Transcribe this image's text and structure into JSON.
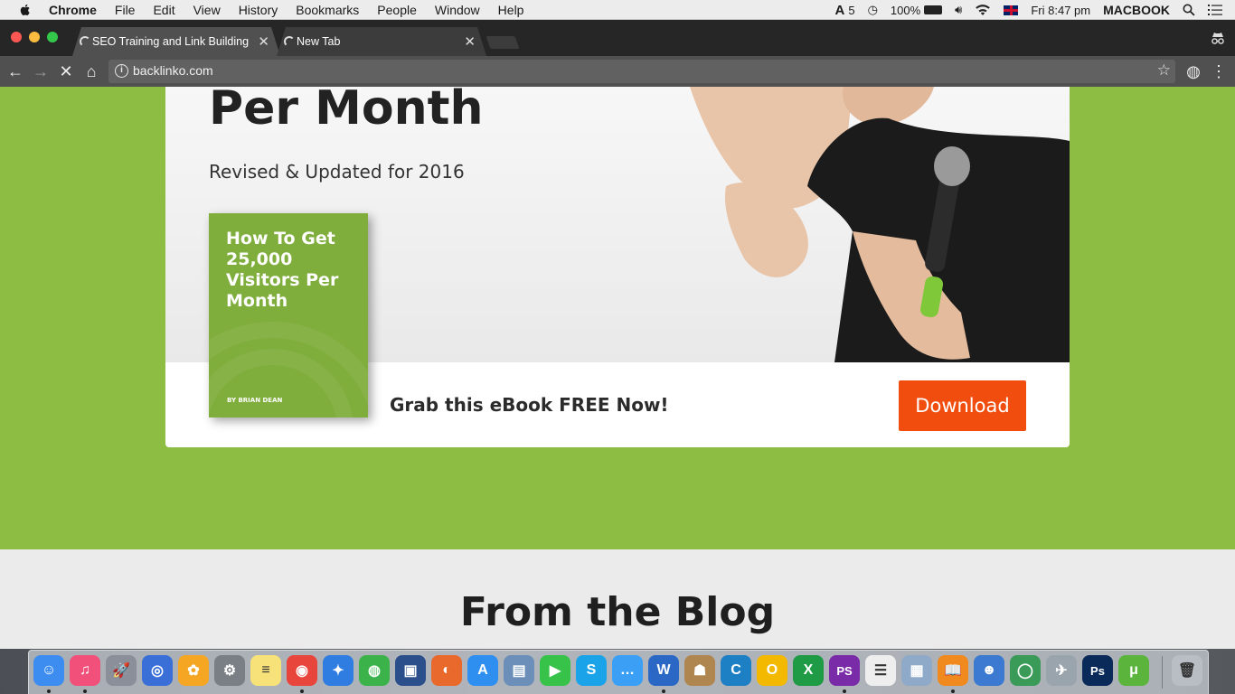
{
  "menubar": {
    "app_name": "Chrome",
    "items": [
      "File",
      "Edit",
      "View",
      "History",
      "Bookmarks",
      "People",
      "Window",
      "Help"
    ],
    "adobe_count": "5",
    "battery": "100%",
    "clock": "Fri 8:47 pm",
    "user": "MACBOOK"
  },
  "tabs": [
    {
      "label": "SEO Training and Link Building",
      "close": "✕"
    },
    {
      "label": "New Tab",
      "close": "✕"
    }
  ],
  "toolbar": {
    "url": "backlinko.com"
  },
  "hero": {
    "title": "Per Month",
    "subtitle": "Revised & Updated for 2016"
  },
  "ebook": {
    "title": "How To Get 25,000 Visitors Per Month",
    "author": "BY BRIAN DEAN"
  },
  "cta": {
    "text": "Grab this eBook FREE Now!",
    "button": "Download"
  },
  "blog": {
    "title": "From the Blog"
  },
  "colors": {
    "page_green": "#8dbd42",
    "download_orange": "#f04d0f",
    "ebook_green": "#7fae3c"
  },
  "dock": [
    {
      "name": "finder",
      "color": "#3d8cf0",
      "glyph": "☺"
    },
    {
      "name": "itunes",
      "color": "#f0507a",
      "glyph": "♫"
    },
    {
      "name": "launchpad",
      "color": "#8a8f99",
      "glyph": "🚀"
    },
    {
      "name": "ios-app",
      "color": "#3a6fd8",
      "glyph": "◎"
    },
    {
      "name": "photos",
      "color": "#f5a623",
      "glyph": "✿"
    },
    {
      "name": "system-preferences",
      "color": "#7a7e85",
      "glyph": "⚙"
    },
    {
      "name": "notes",
      "color": "#f7e27a",
      "glyph": "≡"
    },
    {
      "name": "chrome",
      "color": "#e8453c",
      "glyph": "◉"
    },
    {
      "name": "safari",
      "color": "#2f7de1",
      "glyph": "✦"
    },
    {
      "name": "network-app",
      "color": "#3bb34a",
      "glyph": "◍"
    },
    {
      "name": "remote-app",
      "color": "#2a4f8a",
      "glyph": "▣"
    },
    {
      "name": "firefox",
      "color": "#e8692b",
      "glyph": "◐"
    },
    {
      "name": "app-store",
      "color": "#2e8ff0",
      "glyph": "A"
    },
    {
      "name": "preview",
      "color": "#6b8fb8",
      "glyph": "▤"
    },
    {
      "name": "facetime",
      "color": "#37c24a",
      "glyph": "▶"
    },
    {
      "name": "skype",
      "color": "#1aa3e8",
      "glyph": "S"
    },
    {
      "name": "messages",
      "color": "#3ba0f5",
      "glyph": "…"
    },
    {
      "name": "word",
      "color": "#2b68c5",
      "glyph": "W"
    },
    {
      "name": "contacts",
      "color": "#b08650",
      "glyph": "☗"
    },
    {
      "name": "c-app",
      "color": "#1d7fc4",
      "glyph": "C"
    },
    {
      "name": "outlook",
      "color": "#f2b900",
      "glyph": "O"
    },
    {
      "name": "excel",
      "color": "#1f9a45",
      "glyph": "X"
    },
    {
      "name": "phpstorm",
      "color": "#7a2ba8",
      "glyph": "PS"
    },
    {
      "name": "reminders",
      "color": "#eeeeee",
      "glyph": "☰"
    },
    {
      "name": "image-capture",
      "color": "#8fa9c9",
      "glyph": "▦"
    },
    {
      "name": "ibooks",
      "color": "#f08a1e",
      "glyph": "📖"
    },
    {
      "name": "people-app",
      "color": "#3b7ad0",
      "glyph": "☻"
    },
    {
      "name": "globe-app",
      "color": "#3a9b58",
      "glyph": "◯"
    },
    {
      "name": "network-radar",
      "color": "#9aa4ad",
      "glyph": "✈"
    },
    {
      "name": "photoshop",
      "color": "#0a2a5a",
      "glyph": "Ps"
    },
    {
      "name": "utorrent",
      "color": "#5bb53c",
      "glyph": "μ"
    },
    {
      "name": "trash",
      "color": "#b9bec4",
      "glyph": "🗑"
    }
  ]
}
